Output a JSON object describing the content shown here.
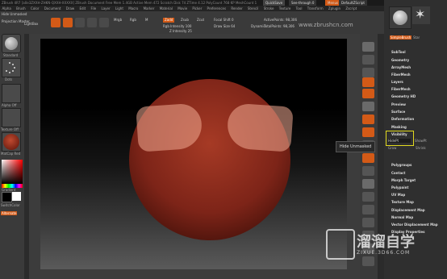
{
  "title_bar": {
    "text": "ZBrush 4R7 [a0e3ZXXH-ZHKN-QXXH-XXXXX] ZBrush Document Free Mem 1.4GB Active Mem 472 Scratch Disk 74 ZTime 4.12 PolyCount 768 KP MeshCount 1",
    "quicksave": "QuickSave",
    "seethrough": "See-through 0",
    "menus_label": "Menus",
    "default_script": "DefaultZScript"
  },
  "menubar": {
    "items": [
      "Alpha",
      "Brush",
      "Color",
      "Document",
      "Draw",
      "Edit",
      "File",
      "Layer",
      "Light",
      "Macro",
      "Marker",
      "Material",
      "Movie",
      "Picker",
      "Preferences",
      "Render",
      "Stencil",
      "Stroke",
      "Texture",
      "Tool",
      "Transform",
      "Zplugin",
      "Zscript"
    ]
  },
  "toolbar": {
    "hide_unmasked_label": "Hide Unmasked",
    "projection_master": "Projection Master",
    "lightbox": "LightBox",
    "mrgb": "Mrgb",
    "rgb": "Rgb",
    "m": "M",
    "zadd": "Zadd",
    "zsub": "Zsub",
    "zcut": "Zcut",
    "focal_shift": "Focal Shift 0",
    "draw_size": "Draw Size 64",
    "z_intensity": "Z Intensity 25",
    "rgb_intensity": "Rgb Intensity 100",
    "dynamic": "Dynamic",
    "active_points": "ActivePoints: 98,306",
    "total_points": "TotalPoints: 98,306",
    "url": "www.zbrushcn.com"
  },
  "left_panel": {
    "standard": "Standard",
    "dots": "Dots",
    "alpha_off": "Alpha Off",
    "texture_off": "Texture Off",
    "material": "MatCap Red",
    "gradient": "Gradient",
    "switch_color": "SwitchColor",
    "alternate": "Alternate"
  },
  "right_icons": [
    "BPR",
    "SPix 3",
    "Scroll",
    "Zoom",
    "Actual",
    "AAHalf",
    "Persp",
    "Floor",
    "Local",
    "L.Sym",
    "Frame",
    "Move",
    "Scale",
    "Rotate",
    "PolyF",
    "Transp",
    "Ghost",
    "Solo",
    "Xpose"
  ],
  "subtool_panel": {
    "tool_thumb": "SimpleBrush",
    "star_label": "Star",
    "polymesh": "PolyMesh3D",
    "items": [
      "SubTool",
      "Geometry",
      "ArrayMesh",
      "FiberMesh",
      "Layers",
      "FiberMesh",
      "Geometry HD",
      "Preview",
      "Surface",
      "Deformation",
      "Masking"
    ],
    "visibility": "Visibility",
    "visibility_field": "HidePt",
    "show_pt": "ShowPt",
    "grow": "Grow",
    "shrink": "Shrink",
    "items_after": [
      "Polygroups",
      "Contact",
      "Morph Target",
      "Polypaint",
      "UV Map",
      "Texture Map",
      "Displacement Map",
      "Normal Map",
      "Vector Displacement Map",
      "Display Properties"
    ]
  },
  "viewport": {
    "tooltip": "Hide Unmasked",
    "sphere_color": "#7d2418",
    "highlight_color": "#f0aa91",
    "highlight_box_color": "#e2da1f"
  },
  "watermark": {
    "cn": "溜溜自学",
    "en": "ZIXUE.3D66.COM"
  }
}
